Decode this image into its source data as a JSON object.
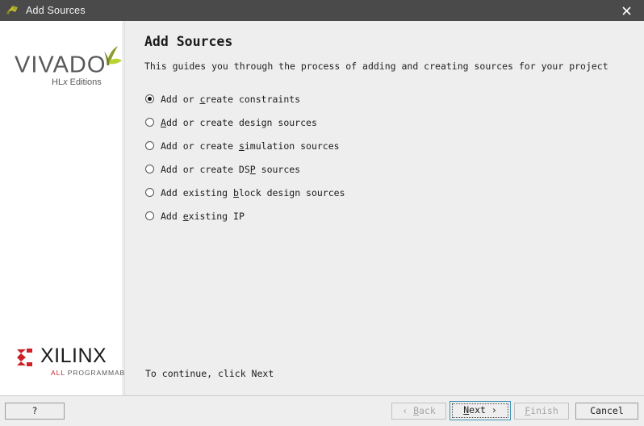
{
  "window": {
    "title": "Add Sources",
    "icon": "vivado-logo-icon",
    "close_icon": "close-icon",
    "titlebar_color": "#4a4a4a",
    "background_color": "#eeeeee",
    "panel_color": "#ffffff"
  },
  "sidebar": {
    "vivado": {
      "wordmark": "VIVADO",
      "trademark": ".",
      "subtitle_prefix": "HL",
      "subtitle_italic": "x",
      "subtitle_suffix": " Editions",
      "leaf_icon": "vivado-leaf-icon",
      "leaf_color": "#a6ce39",
      "text_color": "#58595b"
    },
    "xilinx": {
      "wordmark": "XILINX",
      "mark_icon": "xilinx-mark-icon",
      "tagline_red": "ALL",
      "tagline_rest": " PROGRAMMABLE.",
      "mark_color": "#cf2027"
    }
  },
  "main": {
    "title": "Add Sources",
    "subtitle": "This guides you through the process of adding and creating sources for your project",
    "continue_note": "To continue, click Next",
    "options": [
      {
        "id": "add-or-create-constraints",
        "pre": "Add or ",
        "mnemonic": "c",
        "post": "reate constraints",
        "selected": true
      },
      {
        "id": "add-or-create-design-sources",
        "pre": "",
        "mnemonic": "A",
        "post": "dd or create design sources",
        "selected": false
      },
      {
        "id": "add-or-create-simulation-sources",
        "pre": "Add or create ",
        "mnemonic": "s",
        "post": "imulation sources",
        "selected": false
      },
      {
        "id": "add-or-create-dsp-sources",
        "pre": "Add or create DS",
        "mnemonic": "P",
        "post": " sources",
        "selected": false
      },
      {
        "id": "add-existing-block-design-sources",
        "pre": "Add existing ",
        "mnemonic": "b",
        "post": "lock design sources",
        "selected": false
      },
      {
        "id": "add-existing-ip",
        "pre": "Add ",
        "mnemonic": "e",
        "post": "xisting IP",
        "selected": false
      }
    ]
  },
  "footer": {
    "help_label": "?",
    "back": {
      "pre": "‹ ",
      "mnemonic": "B",
      "post": "ack",
      "enabled": false
    },
    "next": {
      "pre": "",
      "mnemonic": "N",
      "post": "ext ›",
      "enabled": true,
      "focused": true,
      "focus_color": "#3c8fb0"
    },
    "finish": {
      "pre": "",
      "mnemonic": "F",
      "post": "inish",
      "enabled": false
    },
    "cancel": {
      "pre": "",
      "mnemonic": "",
      "post": "Cancel",
      "enabled": true
    }
  }
}
